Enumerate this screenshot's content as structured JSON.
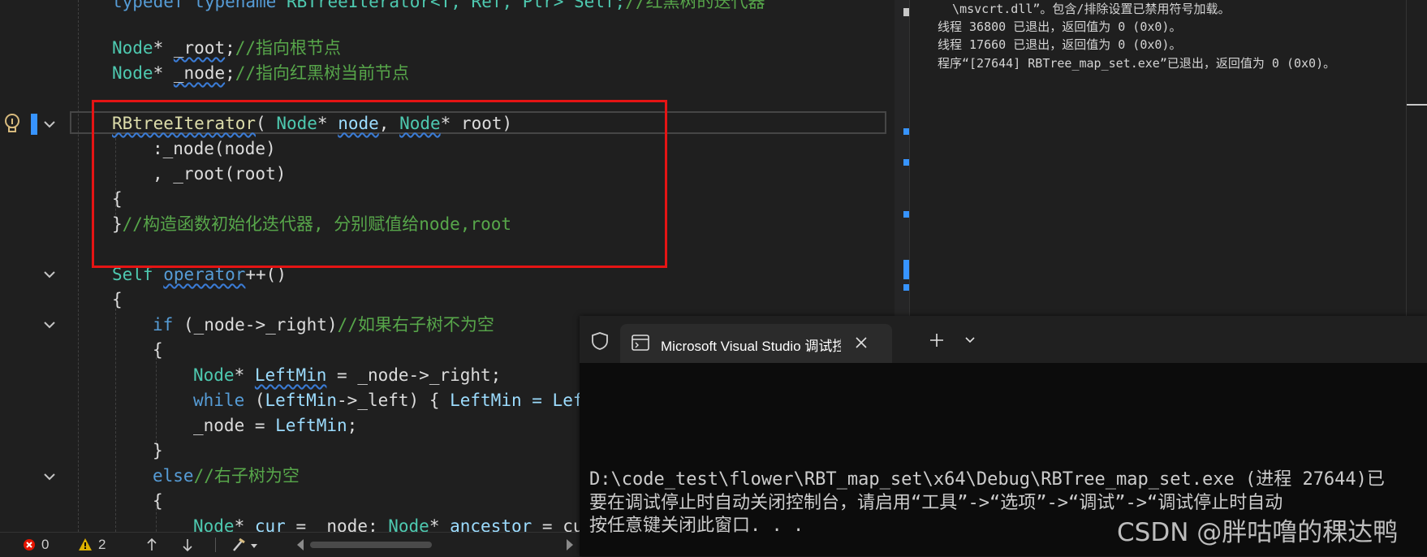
{
  "editor": {
    "lines": {
      "l0": {
        "typedef": "typedef",
        "typename": "typename",
        "rest": " RBTreeIterator<T, Ref, Ptr> Self;",
        "comment": "//红黑树的迭代器"
      },
      "l1": {
        "type": "Node",
        "star": "* ",
        "name": "_root",
        "semi": ";",
        "comment": "//指向根节点"
      },
      "l2": {
        "type": "Node",
        "star": "* ",
        "name": "_node",
        "semi": ";",
        "comment": "//指向红黑树当前节点"
      },
      "l3": {
        "fn": "RBtreeIterator",
        "p1": "( ",
        "t1": "Node",
        "s1": "* ",
        "a1": "node",
        "p2": ", ",
        "t2": "Node",
        "s2": "* ",
        "a2": "root",
        "p3": ")"
      },
      "l4": ":_node(node)",
      "l5": ", _root(root)",
      "l6": "{",
      "l7": {
        "brace": "}",
        "comment": "//构造函数初始化迭代器, 分别赋值给node,root"
      },
      "l8": {
        "type": "Self",
        "op": "operator",
        "rest": "++()"
      },
      "l9": "{",
      "l10": {
        "kw": "if",
        "rest": " (_node->_right)",
        "comment": "//如果右子树不为空"
      },
      "l11": "{",
      "l12": {
        "type": "Node",
        "star": "* ",
        "var": "LeftMin",
        "rest": " = _node->_right;"
      },
      "l13": {
        "kw": "while",
        "p1": " (",
        "v1": "LeftMin",
        "p2": "->_left) { ",
        "v2": "LeftMin",
        "p3": " = Left"
      },
      "l14": {
        "pre": "_node = ",
        "var": "LeftMin",
        "post": ";"
      },
      "l15": "}",
      "l16": {
        "kw": "else",
        "comment": "//右子树为空"
      },
      "l17": "{",
      "l18": {
        "type": "Node",
        "star": "* ",
        "var": "cur",
        "p1": " = _node; ",
        "type2": "Node",
        "star2": "* ",
        "var2": "ancestor",
        "p2": " = cu"
      }
    }
  },
  "output": {
    "lines": [
      "  \\msvcrt.dll”。包含/排除设置已禁用符号加载。",
      "线程 36800 已退出，返回值为 0 (0x0)。",
      "线程 17660 已退出，返回值为 0 (0x0)。",
      "程序“[27644] RBTree_map_set.exe”已退出，返回值为 0 (0x0)。"
    ]
  },
  "status": {
    "errors": "0",
    "warnings": "2"
  },
  "console": {
    "tab_title": "Microsoft Visual Studio 调试控",
    "lines": [
      "D:\\code_test\\flower\\RBT_map_set\\x64\\Debug\\RBTree_map_set.exe (进程 27644)已",
      "要在调试停止时自动关闭控制台，请启用“工具”->“选项”->“调试”->“调试停止时自动",
      "按任意键关闭此窗口. . ."
    ]
  },
  "watermark": "CSDN @胖咕噜的稞达鸭",
  "colors": {
    "highlight_box": "#e51414",
    "keyword": "#569cd6",
    "type": "#4ec9b0",
    "comment": "#57a64a",
    "function": "#dcdcaa"
  },
  "icons": [
    "lightbulb-icon",
    "chevron-down-icon",
    "error-icon",
    "warning-icon",
    "shield-icon",
    "console-icon",
    "close-icon",
    "plus-icon"
  ]
}
